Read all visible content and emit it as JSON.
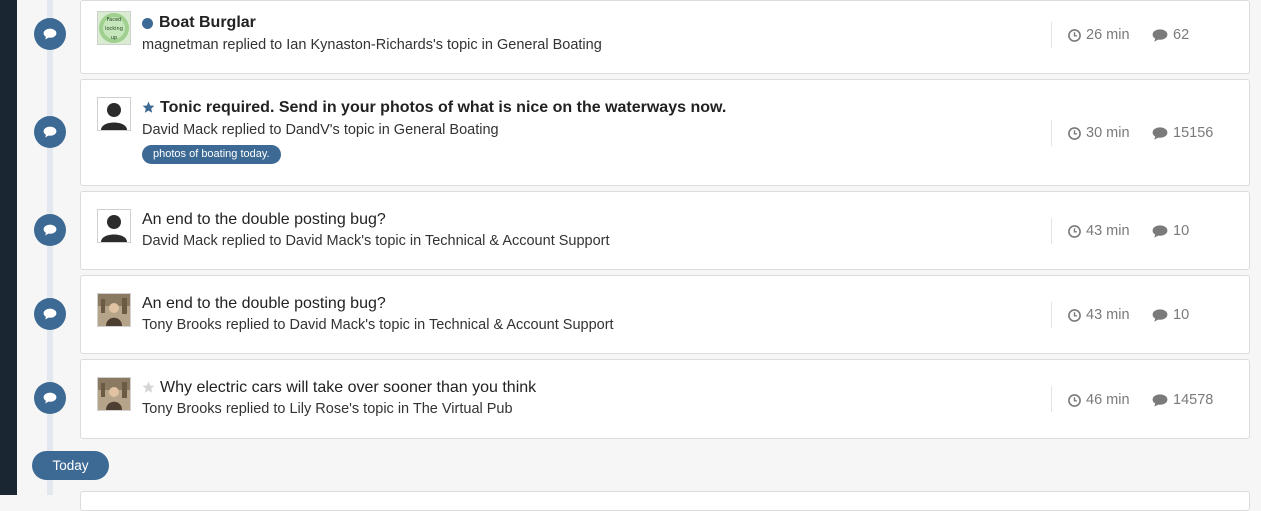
{
  "colors": {
    "accent": "#3d6a94",
    "sidebar": "#1a2632",
    "background": "#f6f6f6",
    "muted_text": "#7a7a7a"
  },
  "activity": [
    {
      "title": "Boat Burglar",
      "title_style": "bold",
      "prefix_icon": "unread-dot",
      "meta": "magnetman replied to Ian Kynaston-Richards's topic in General Boating",
      "time": "26 min",
      "replies": "62",
      "avatar": "green-badge-avatar-with-text",
      "avatar_text": [
        "Faced",
        "locking",
        "up"
      ]
    },
    {
      "title": "Tonic required. Send in your photos of what is nice on the waterways now.",
      "title_style": "bold",
      "prefix_icon": "star-filled-icon",
      "meta": "David Mack replied to DandV's topic in General Boating",
      "tag": "photos of boating today.",
      "time": "30 min",
      "replies": "15156",
      "avatar": "default-silhouette-avatar"
    },
    {
      "title": "An end to the double posting bug?",
      "title_style": "normal",
      "meta": "David Mack replied to David Mack's topic in Technical & Account Support",
      "time": "43 min",
      "replies": "10",
      "avatar": "default-silhouette-avatar"
    },
    {
      "title": "An end to the double posting bug?",
      "title_style": "normal",
      "meta": "Tony Brooks replied to David Mack's topic in Technical & Account Support",
      "time": "43 min",
      "replies": "10",
      "avatar": "photo-avatar"
    },
    {
      "title": "Why electric cars will take over sooner than you think",
      "title_style": "normal",
      "prefix_icon": "star-outline-icon",
      "meta": "Tony Brooks replied to Lily Rose's topic in The Virtual Pub",
      "time": "46 min",
      "replies": "14578",
      "avatar": "photo-avatar"
    }
  ],
  "timeline_marker": "Today",
  "icons": {
    "timeline": "comment-bubble-icon",
    "time": "clock-icon",
    "replies": "comment-icon"
  }
}
